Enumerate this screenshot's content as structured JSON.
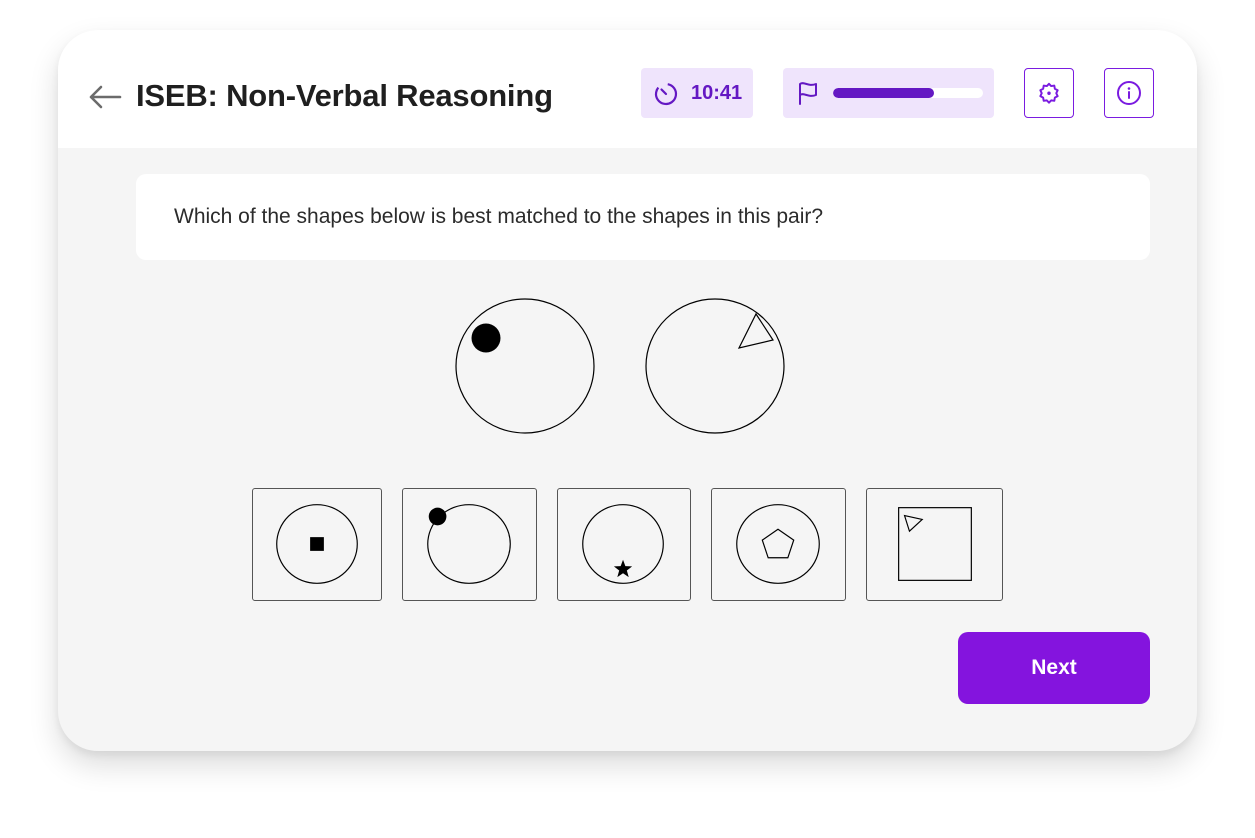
{
  "header": {
    "title": "ISEB: Non-Verbal Reasoning",
    "back_icon": "arrow-left-icon",
    "timer": {
      "icon": "timer-icon",
      "value": "10:41"
    },
    "progress": {
      "icon": "flag-icon",
      "fraction": 0.67
    },
    "settings_icon": "gear-icon",
    "info_icon": "info-icon"
  },
  "colors": {
    "accent": "#8414de",
    "accent_dark": "#6418c3",
    "accent_light": "#efe4fc",
    "background": "#f5f5f5"
  },
  "question": {
    "text": "Which of the shapes below is best matched to the shapes in this pair?",
    "pair": [
      {
        "outer": "circle",
        "inner": "filled-circle",
        "inner_position": "upper-left inside edge"
      },
      {
        "outer": "circle",
        "inner": "outline-triangle",
        "inner_position": "upper-right inside edge"
      }
    ],
    "options": [
      {
        "id": "A",
        "outer": "circle",
        "inner": "filled-square",
        "inner_position": "center"
      },
      {
        "id": "B",
        "outer": "circle",
        "inner": "filled-circle",
        "inner_position": "on edge upper-left"
      },
      {
        "id": "C",
        "outer": "circle",
        "inner": "filled-star",
        "inner_position": "bottom inside edge"
      },
      {
        "id": "D",
        "outer": "circle",
        "inner": "outline-pentagon",
        "inner_position": "center"
      },
      {
        "id": "E",
        "outer": "square",
        "inner": "outline-triangle",
        "inner_position": "upper-left corner"
      }
    ]
  },
  "actions": {
    "next_label": "Next"
  }
}
